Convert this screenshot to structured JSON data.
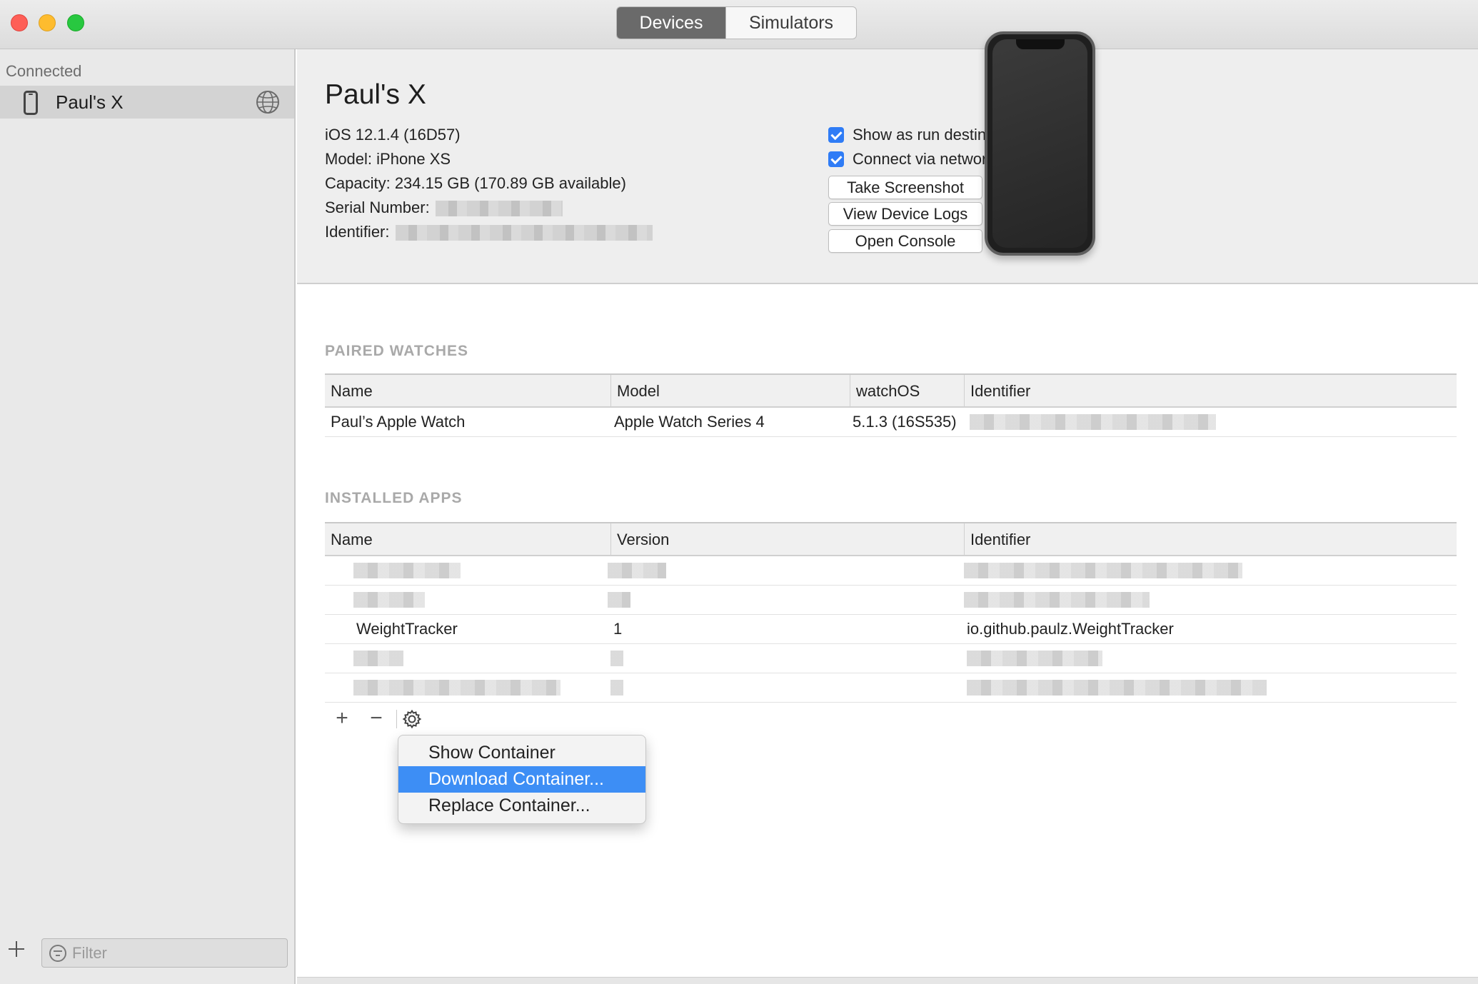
{
  "toolbar": {
    "tabs": [
      "Devices",
      "Simulators"
    ],
    "selected_tab": "Devices"
  },
  "sidebar": {
    "heading": "Connected",
    "items": [
      {
        "label": "Paul's X",
        "icon": "iphone-icon",
        "status_icon": "network-globe-icon"
      }
    ],
    "add_icon": "plus-icon",
    "filter_placeholder": "Filter"
  },
  "device": {
    "name": "Paul's X",
    "os": "iOS 12.1.4 (16D57)",
    "model": "Model: iPhone XS",
    "capacity": "Capacity: 234.15 GB (170.89 GB available)",
    "serial_label": "Serial Number:",
    "identifier_label": "Identifier:",
    "options": [
      {
        "label": "Show as run destination",
        "checked": true
      },
      {
        "label": "Connect via network",
        "checked": true
      }
    ],
    "buttons": [
      "Take Screenshot",
      "View Device Logs",
      "Open Console"
    ]
  },
  "paired_watches": {
    "heading": "PAIRED WATCHES",
    "columns": [
      "Name",
      "Model",
      "watchOS",
      "Identifier"
    ],
    "rows": [
      {
        "name": "Paul’s Apple Watch",
        "model": "Apple Watch Series 4",
        "watchos": "5.1.3 (16S535)"
      }
    ]
  },
  "installed_apps": {
    "heading": "INSTALLED APPS",
    "columns": [
      "Name",
      "Version",
      "Identifier"
    ],
    "visible_row": {
      "name": "WeightTracker",
      "version": "1",
      "identifier": "io.github.paulz.WeightTracker"
    }
  },
  "table_footer": {
    "add_symbol": "+",
    "remove_symbol": "−",
    "gear_icon": "gear-icon"
  },
  "context_menu": {
    "items": [
      "Show Container",
      "Download Container...",
      "Replace Container..."
    ],
    "selected": "Download Container..."
  },
  "colors": {
    "accent": "#3d8ef5",
    "checkbox": "#2f7cf6",
    "selected_tab": "#6a6a6a"
  }
}
